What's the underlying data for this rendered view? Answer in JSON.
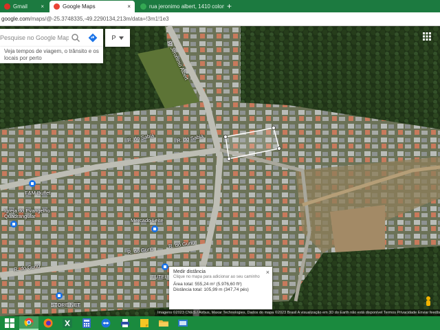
{
  "browser": {
    "tabs": [
      {
        "label": "Gmail",
        "active": false,
        "color": "#d93025"
      },
      {
        "label": "Google Maps",
        "active": true,
        "color": "#ea4335"
      },
      {
        "label": "rua jeronimo albert, 1410 colom",
        "active": false,
        "color": "#34a853"
      }
    ],
    "new_tab": "+",
    "close_glyph": "×",
    "url_host": "google.com",
    "url_rest": "/maps/@-25.3748335,-49.2290134,213m/data=!3m1!1e3"
  },
  "search": {
    "placeholder": "Pesquise no Google Maps",
    "suggestion": "Veja tempos de viagem, o trânsito e os locais por perto",
    "mode_label": "P"
  },
  "map_labels": {
    "streets": [
      {
        "id": "jeronimo-albert",
        "text": "R. Jeronimo Albert"
      },
      {
        "id": "sabia-1",
        "text": "R. do Sabiá"
      },
      {
        "id": "sabia-2",
        "text": "R. do Sabiá"
      },
      {
        "id": "guriu-1",
        "text": "R. do Guriú"
      },
      {
        "id": "guriu-2",
        "text": "R. do Guriú"
      },
      {
        "id": "guriu-3",
        "text": "R. do Guriú"
      }
    ],
    "places": [
      {
        "id": "fm-buffet",
        "text": "F&M Buffet"
      },
      {
        "id": "igreja",
        "text": "Igreja do Evangelho Quadrangular"
      },
      {
        "id": "mercado-leite",
        "text": "Mercado Leite"
      },
      {
        "id": "futel",
        "text": "FUTEL"
      },
      {
        "id": "store",
        "text": "STORE NET"
      }
    ]
  },
  "measure": {
    "title": "Medir distância",
    "hint": "Clique no mapa para adicionar ao seu caminho",
    "area": "Área total: 555,24 m² (5.976,60 ft²)",
    "distance": "Distância total: 105,99 m (347,74 pés)"
  },
  "attribution": "Imagens ©2023 CNES / Airbus, Maxar Technologies, Dados do mapa ©2023    Brasil    A visualização em 3D do Earth não está disponível    Termos    Privacidade    Enviar feedback",
  "taskbar": {
    "apps": [
      {
        "name": "windows-start-icon",
        "color": "#3b95ff"
      },
      {
        "name": "chrome-icon",
        "color": "#ea4335",
        "active": true
      },
      {
        "name": "firefox-icon",
        "color": "#ff7b1a"
      },
      {
        "name": "excel-icon",
        "color": "#1d7a45"
      },
      {
        "name": "calculator-icon",
        "color": "#3a6bd1"
      },
      {
        "name": "teamviewer-icon",
        "color": "#1e6fe0"
      },
      {
        "name": "printer-icon",
        "color": "#2d4fa5"
      },
      {
        "name": "sticky-notes-icon",
        "color": "#f6c624"
      },
      {
        "name": "folder-icon",
        "color": "#e8b73a"
      },
      {
        "name": "sap-icon",
        "color": "#2a76c9"
      }
    ]
  },
  "colors": {
    "accent": "#1a73e8",
    "taskbar": "#1a8a3e",
    "tabstrip": "#1c7a40"
  }
}
